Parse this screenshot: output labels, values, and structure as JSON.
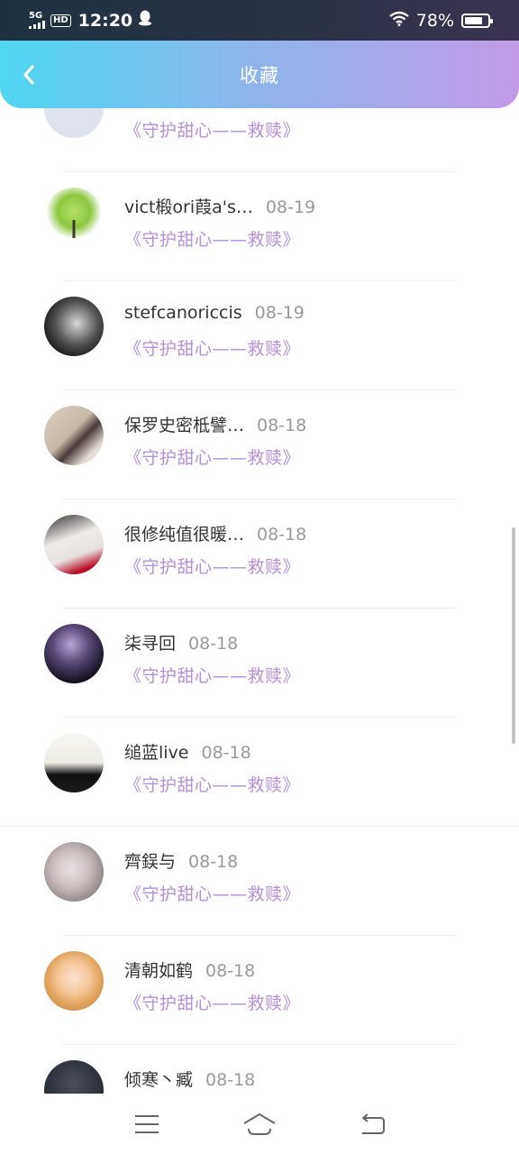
{
  "status_bar": {
    "network": "5G",
    "hd": "HD",
    "time": "12:20",
    "battery": "78%",
    "battery_level": 0.78
  },
  "header": {
    "title": "收藏"
  },
  "list": {
    "partial_top": {
      "story": "《守护甜心——救赎》"
    },
    "items": [
      {
        "name": "vict椴ori葭a's…",
        "date": "08-19",
        "story": "《守护甜心——救赎》"
      },
      {
        "name": "stefcanoriccis",
        "date": "08-19",
        "story": "《守护甜心——救赎》"
      },
      {
        "name": "保罗史密柢譬…",
        "date": "08-18",
        "story": "《守护甜心——救赎》"
      },
      {
        "name": "很修纯值很暖…",
        "date": "08-18",
        "story": "《守护甜心——救赎》"
      },
      {
        "name": "柒寻回",
        "date": "08-18",
        "story": "《守护甜心——救赎》"
      },
      {
        "name": "缒蓝live",
        "date": "08-18",
        "story": "《守护甜心——救赎》"
      },
      {
        "name": "齊鋘与",
        "date": "08-18",
        "story": "《守护甜心——救赎》"
      },
      {
        "name": "清朝如鹤",
        "date": "08-18",
        "story": "《守护甜心——救赎》"
      },
      {
        "name": "倾寒丶臧",
        "date": "08-18",
        "story": ""
      }
    ]
  },
  "colors": {
    "header_start": "#4ed6f2",
    "header_end": "#c19ae8",
    "story_purple": "#b58fd8",
    "date_gray": "#999999"
  },
  "icons": {
    "back": "chevron-left-icon",
    "menu": "menu-icon",
    "home": "home-icon",
    "return": "return-icon"
  }
}
